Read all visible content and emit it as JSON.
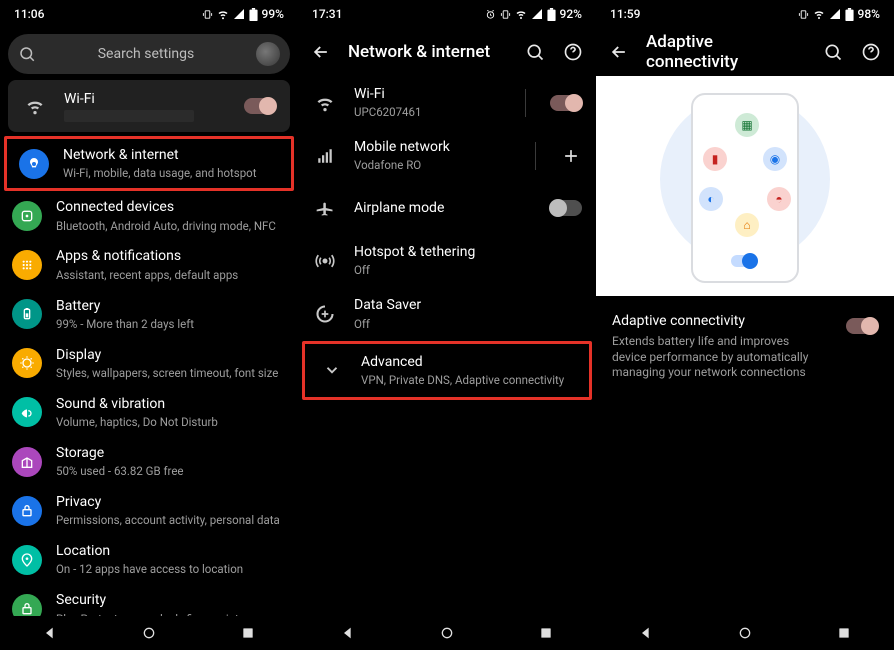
{
  "panel1": {
    "status": {
      "time": "11:06",
      "battery": "99%"
    },
    "search_placeholder": "Search settings",
    "wifi": {
      "title": "Wi-Fi"
    },
    "items": [
      {
        "icon_bg": "#1a73e8",
        "title": "Network & internet",
        "sub": "Wi-Fi, mobile, data usage, and hotspot",
        "highlight": true
      },
      {
        "icon_bg": "#34a853",
        "title": "Connected devices",
        "sub": "Bluetooth, Android Auto, driving mode, NFC"
      },
      {
        "icon_bg": "#f9ab00",
        "title": "Apps & notifications",
        "sub": "Assistant, recent apps, default apps"
      },
      {
        "icon_bg": "#009688",
        "title": "Battery",
        "sub": "99% - More than 2 days left"
      },
      {
        "icon_bg": "#f9ab00",
        "title": "Display",
        "sub": "Styles, wallpapers, screen timeout, font size"
      },
      {
        "icon_bg": "#00bfa5",
        "title": "Sound & vibration",
        "sub": "Volume, haptics, Do Not Disturb"
      },
      {
        "icon_bg": "#ab47bc",
        "title": "Storage",
        "sub": "50% used - 63.82 GB free"
      },
      {
        "icon_bg": "#1a73e8",
        "title": "Privacy",
        "sub": "Permissions, account activity, personal data"
      },
      {
        "icon_bg": "#00bfa5",
        "title": "Location",
        "sub": "On - 12 apps have access to location"
      },
      {
        "icon_bg": "#34a853",
        "title": "Security",
        "sub": "Play Protect, screen lock, fingerprint"
      }
    ]
  },
  "panel2": {
    "status": {
      "time": "17:31",
      "battery": "92%"
    },
    "header": "Network & internet",
    "rows": [
      {
        "icon": "wifi",
        "title": "Wi-Fi",
        "sub": "UPC6207461",
        "trailing": "toggle-on"
      },
      {
        "icon": "signal",
        "title": "Mobile network",
        "sub": "Vodafone RO",
        "trailing": "plus"
      },
      {
        "icon": "airplane",
        "title": "Airplane mode",
        "sub": "",
        "trailing": "toggle-off"
      },
      {
        "icon": "hotspot",
        "title": "Hotspot & tethering",
        "sub": "Off",
        "trailing": ""
      },
      {
        "icon": "datasaver",
        "title": "Data Saver",
        "sub": "Off",
        "trailing": ""
      },
      {
        "icon": "chevron",
        "title": "Advanced",
        "sub": "VPN, Private DNS, Adaptive connectivity",
        "trailing": "",
        "highlight": true
      }
    ]
  },
  "panel3": {
    "status": {
      "time": "11:59",
      "battery": "98%"
    },
    "header": "Adaptive connectivity",
    "setting": {
      "title": "Adaptive connectivity",
      "sub": "Extends battery life and improves device performance by automatically managing your network connections"
    }
  }
}
